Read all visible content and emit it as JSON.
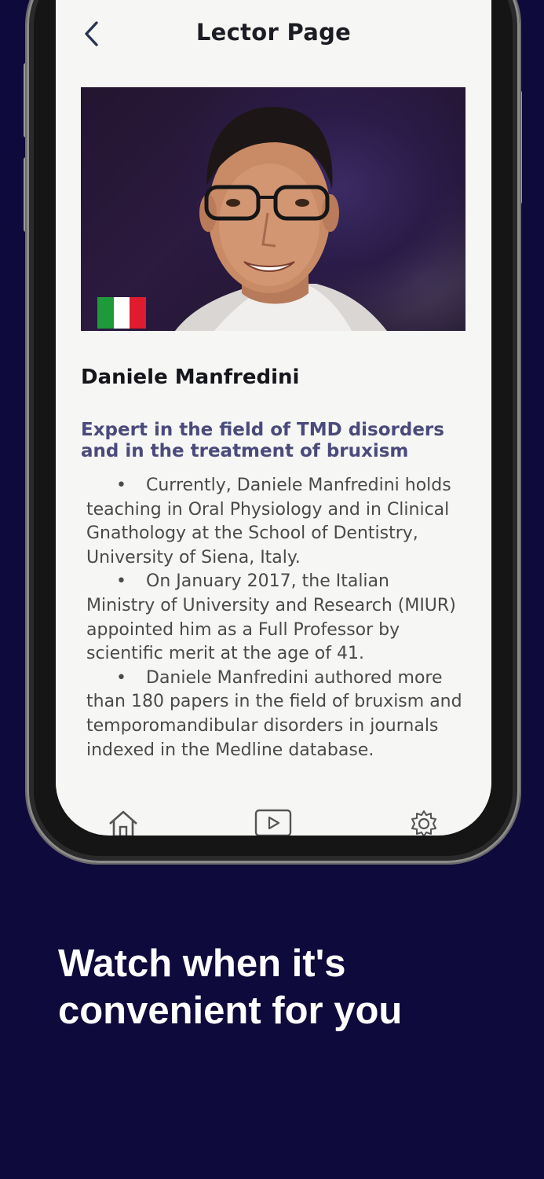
{
  "header": {
    "title": "Lector Page",
    "back_icon": "chevron-left-icon"
  },
  "lector": {
    "name": "Daniele Manfredini",
    "title": "Expert in the field of TMD disorders and in the treatment of bruxism",
    "flag_colors": [
      "#1f9a3b",
      "#ffffff",
      "#e01b2f"
    ],
    "bio": [
      "Currently, Daniele Manfredini holds teaching in Oral Physiology and in Clinical Gnathology at the School of Dentistry, University of Siena, Italy.",
      "On January 2017, the Italian Ministry of University and Research (MIUR) appointed him as a Full Professor by scientific merit at the age of 41.",
      "Daniele Manfredini authored more than 180 papers in the field of bruxism and temporomandibular disorders in journals indexed in the Medline database."
    ],
    "bullet": "•"
  },
  "tabbar": {
    "tabs": [
      "home-icon",
      "play-icon",
      "gear-icon"
    ]
  },
  "promo": {
    "tagline": "Watch when it's convenient for you"
  },
  "colors": {
    "background": "#0f0a3c",
    "accent": "#4a4a7c"
  }
}
